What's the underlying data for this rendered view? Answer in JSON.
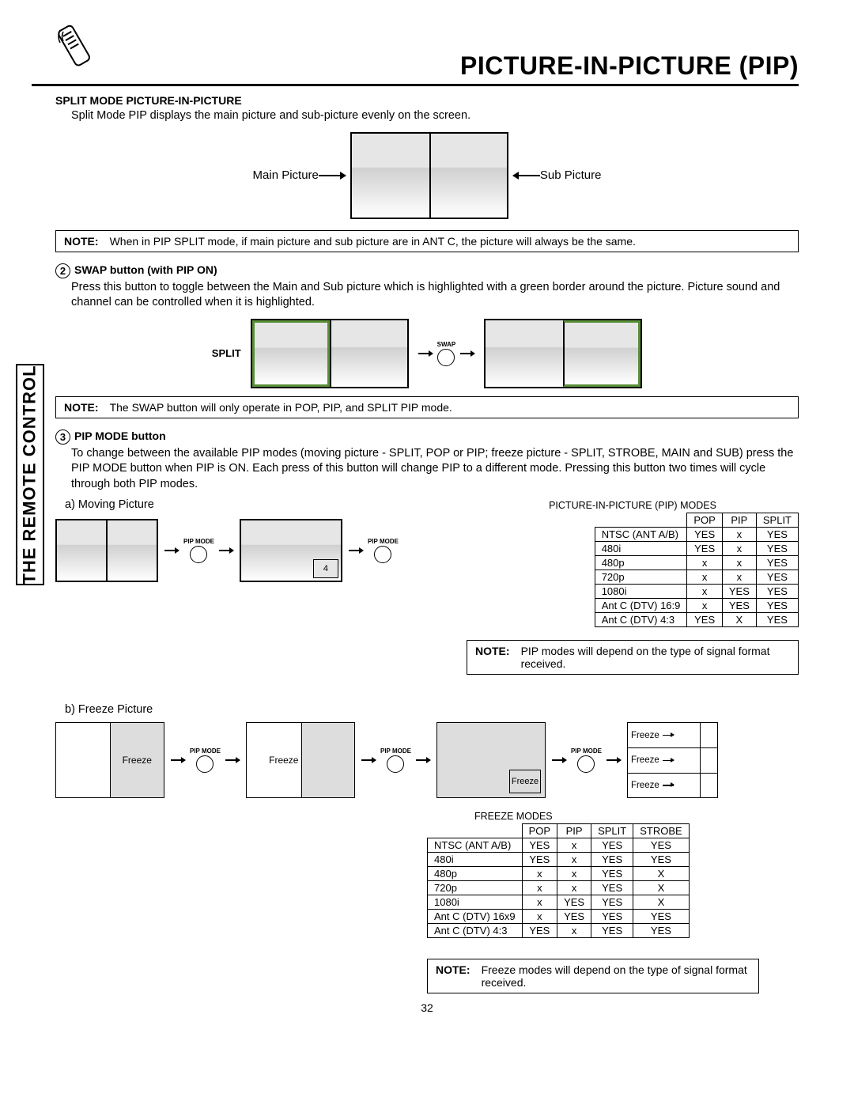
{
  "header": {
    "title": "PICTURE-IN-PICTURE (PIP)"
  },
  "sidebar": {
    "label": "THE REMOTE CONTROL"
  },
  "section1": {
    "title": "SPLIT MODE PICTURE-IN-PICTURE",
    "body": "Split Mode PIP displays the main picture and sub-picture evenly on the screen.",
    "main_label": "Main Picture",
    "sub_label": "Sub Picture",
    "note_label": "NOTE:",
    "note": "When in PIP SPLIT mode, if main picture and sub picture are in ANT C, the picture will always be the same."
  },
  "section2": {
    "num": "2",
    "title": "SWAP button (with PIP ON)",
    "body": "Press this button to toggle between the Main and Sub picture which is highlighted with a green border around the picture.  Picture sound and channel can be controlled when it is highlighted.",
    "split_label": "SPLIT",
    "swap_label": "SWAP",
    "note_label": "NOTE:",
    "note": "The SWAP button will only operate in POP, PIP, and SPLIT PIP mode."
  },
  "section3": {
    "num": "3",
    "title": "PIP MODE button",
    "body": "To change between the available PIP modes (moving picture - SPLIT, POP or PIP; freeze picture - SPLIT, STROBE, MAIN and SUB) press the PIP MODE button when PIP is ON.  Each press of this button will change PIP to a different mode.  Pressing this button two times will cycle through both PIP modes.",
    "sub_a": "a) Moving Picture",
    "sub_b": "b) Freeze Picture",
    "pip_mode_label": "PIP MODE",
    "pip_inset": "4",
    "freeze_label": "Freeze",
    "table1_title": "PICTURE-IN-PICTURE (PIP) MODES",
    "table2_title": "FREEZE MODES",
    "note1_label": "NOTE:",
    "note1": "PIP modes will depend on the type of signal format received.",
    "note2_label": "NOTE:",
    "note2": "Freeze modes will depend on the type of signal format received."
  },
  "pip_table": {
    "cols": [
      "",
      "POP",
      "PIP",
      "SPLIT"
    ],
    "rows": [
      [
        "NTSC (ANT A/B)",
        "YES",
        "x",
        "YES"
      ],
      [
        "480i",
        "YES",
        "x",
        "YES"
      ],
      [
        "480p",
        "x",
        "x",
        "YES"
      ],
      [
        "720p",
        "x",
        "x",
        "YES"
      ],
      [
        "1080i",
        "x",
        "YES",
        "YES"
      ],
      [
        "Ant C (DTV) 16:9",
        "x",
        "YES",
        "YES"
      ],
      [
        "Ant C (DTV) 4:3",
        "YES",
        "X",
        "YES"
      ]
    ]
  },
  "freeze_table": {
    "cols": [
      "",
      "POP",
      "PIP",
      "SPLIT",
      "STROBE"
    ],
    "rows": [
      [
        "NTSC (ANT A/B)",
        "YES",
        "x",
        "YES",
        "YES"
      ],
      [
        "480i",
        "YES",
        "x",
        "YES",
        "YES"
      ],
      [
        "480p",
        "x",
        "x",
        "YES",
        "X"
      ],
      [
        "720p",
        "x",
        "x",
        "YES",
        "X"
      ],
      [
        "1080i",
        "x",
        "YES",
        "YES",
        "X"
      ],
      [
        "Ant C (DTV) 16x9",
        "x",
        "YES",
        "YES",
        "YES"
      ],
      [
        "Ant C (DTV) 4:3",
        "YES",
        "x",
        "YES",
        "YES"
      ]
    ]
  },
  "page_number": "32"
}
